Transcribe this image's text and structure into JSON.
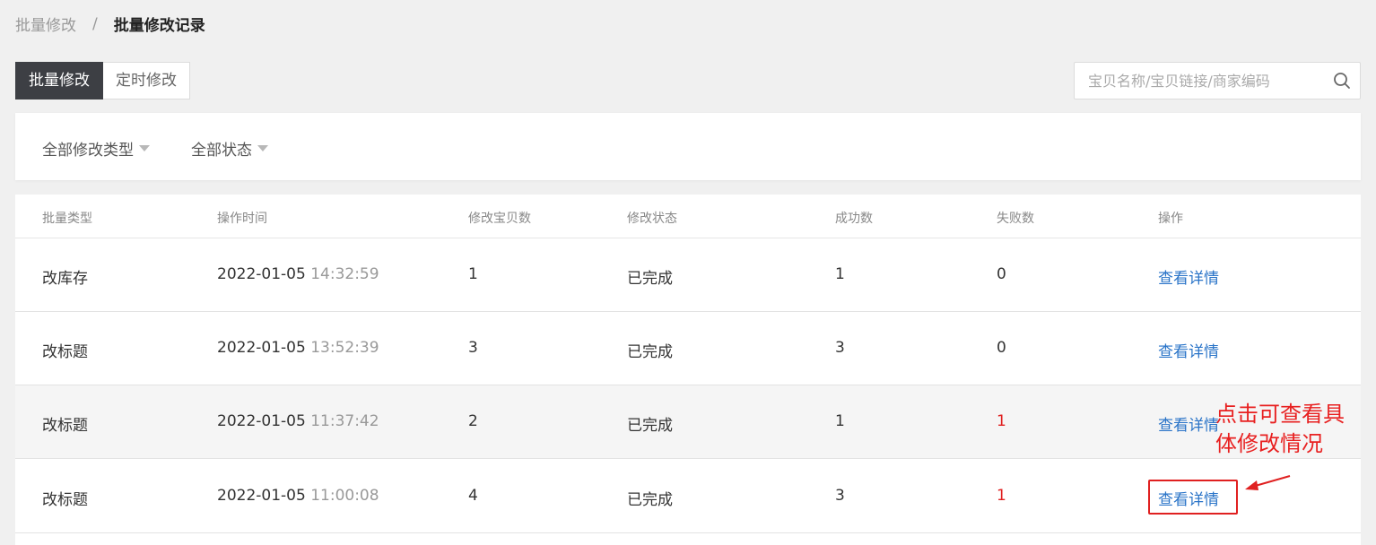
{
  "breadcrumb": {
    "parent": "批量修改",
    "separator": "/",
    "current": "批量修改记录"
  },
  "tabs": [
    {
      "label": "批量修改",
      "active": true
    },
    {
      "label": "定时修改",
      "active": false
    }
  ],
  "search": {
    "placeholder": "宝贝名称/宝贝链接/商家编码",
    "value": "",
    "icon": "search-icon"
  },
  "filters": {
    "type_label": "全部修改类型",
    "status_label": "全部状态"
  },
  "table": {
    "headers": [
      "批量类型",
      "操作时间",
      "修改宝贝数",
      "修改状态",
      "成功数",
      "失败数",
      "操作"
    ],
    "rows": [
      {
        "type": "改库存",
        "date": "2022-01-05",
        "time": "14:32:59",
        "count": "1",
        "status": "已完成",
        "success": "1",
        "fail": "0",
        "action": "查看详情"
      },
      {
        "type": "改标题",
        "date": "2022-01-05",
        "time": "13:52:39",
        "count": "3",
        "status": "已完成",
        "success": "3",
        "fail": "0",
        "action": "查看详情"
      },
      {
        "type": "改标题",
        "date": "2022-01-05",
        "time": "11:37:42",
        "count": "2",
        "status": "已完成",
        "success": "1",
        "fail": "1",
        "action": "查看详情"
      },
      {
        "type": "改标题",
        "date": "2022-01-05",
        "time": "11:00:08",
        "count": "4",
        "status": "已完成",
        "success": "3",
        "fail": "1",
        "action": "查看详情"
      }
    ]
  },
  "annotation": {
    "line1": "点击可查看具",
    "line2": "体修改情况"
  },
  "colors": {
    "active_tab": "#3d3f44",
    "link": "#2a74c8",
    "fail": "#e02020",
    "annotation": "#e82020"
  }
}
